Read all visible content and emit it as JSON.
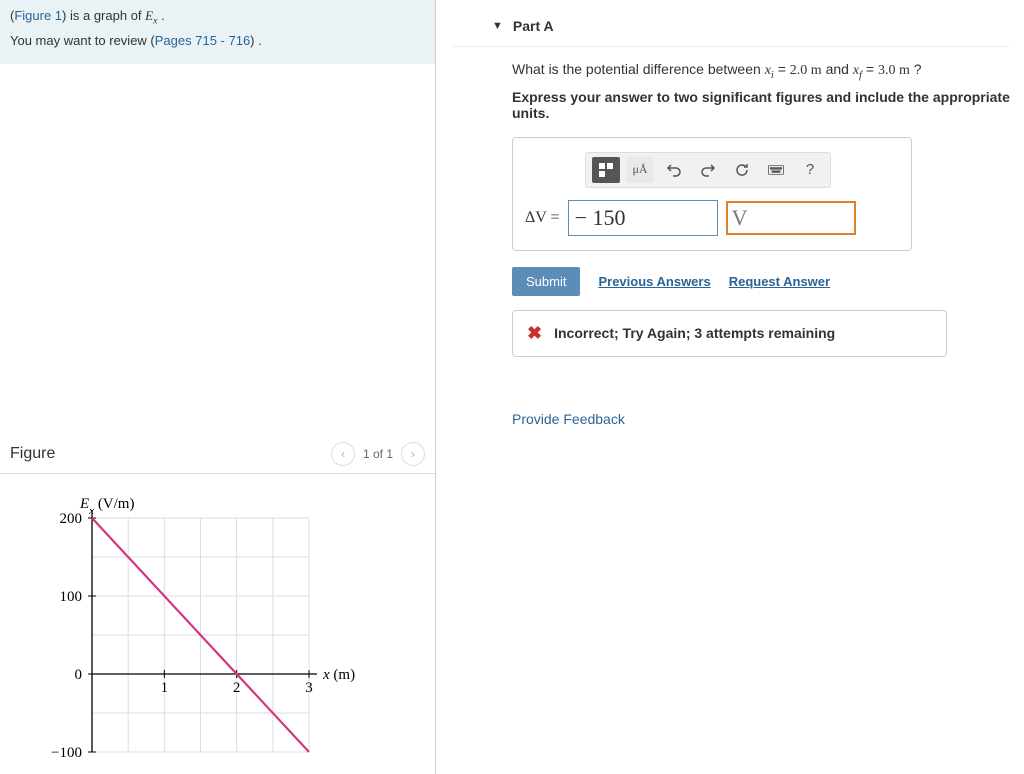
{
  "intro": {
    "figure_link": "Figure 1",
    "line1_suffix": ") is a graph of ",
    "line2_prefix": "You may want to review (",
    "pages_link": "Pages 715 - 716",
    "line2_suffix": ") ."
  },
  "figure_panel": {
    "title": "Figure",
    "nav_text": "1 of 1"
  },
  "chart_data": {
    "type": "line",
    "title": "",
    "xlabel": "x (m)",
    "ylabel": "Eₓ (V/m)",
    "xlim": [
      0,
      3
    ],
    "ylim": [
      -100,
      200
    ],
    "x_ticks": [
      0,
      1,
      2,
      3
    ],
    "y_ticks": [
      -100,
      0,
      100,
      200
    ],
    "series": [
      {
        "name": "E_x",
        "color": "#d63384",
        "points": [
          [
            0,
            200
          ],
          [
            3,
            -100
          ]
        ]
      }
    ]
  },
  "part": {
    "label": "Part A",
    "question_prefix": "What is the potential difference between ",
    "xi_val": "2.0 m",
    "and_text": " and ",
    "xf_val": "3.0 m",
    "question_suffix": " ?",
    "instruction": "Express your answer to two significant figures and include the appropriate units.",
    "dv_label": "ΔV =",
    "dv_value": "− 150",
    "dv_unit_placeholder": "V",
    "submit": "Submit",
    "prev_answers": "Previous Answers",
    "request_answer": "Request Answer",
    "feedback": "Incorrect; Try Again; 3 attempts remaining",
    "toolbar": {
      "units_btn": "μÅ",
      "help": "?"
    }
  },
  "provide_feedback": "Provide Feedback"
}
